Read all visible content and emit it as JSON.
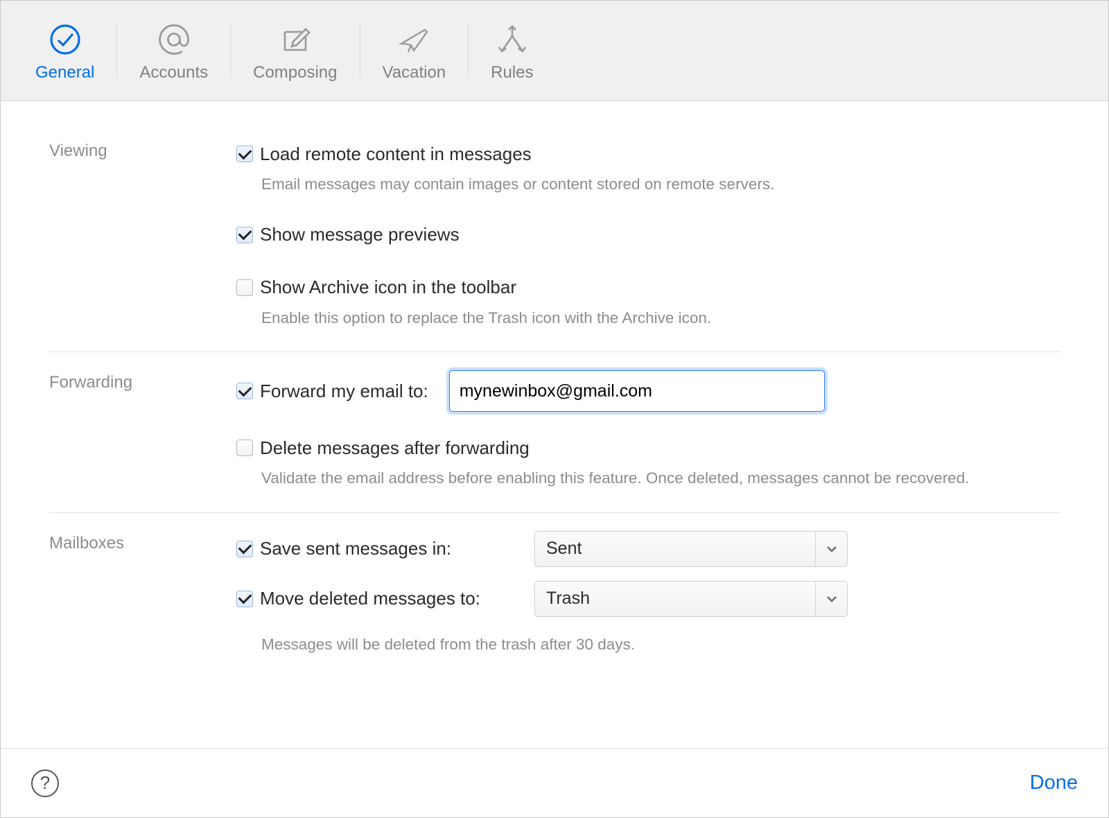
{
  "tabs": {
    "general": "General",
    "accounts": "Accounts",
    "composing": "Composing",
    "vacation": "Vacation",
    "rules": "Rules"
  },
  "sections": {
    "viewing_label": "Viewing",
    "forwarding_label": "Forwarding",
    "mailboxes_label": "Mailboxes"
  },
  "viewing": {
    "load_remote": "Load remote content in messages",
    "load_remote_help": "Email messages may contain images or content stored on remote servers.",
    "show_previews": "Show message previews",
    "show_archive": "Show Archive icon in the toolbar",
    "show_archive_help": "Enable this option to replace the Trash icon with the Archive icon."
  },
  "forwarding": {
    "forward_label": "Forward my email to:",
    "forward_value": "mynewinbox@gmail.com",
    "delete_after": "Delete messages after forwarding",
    "delete_help": "Validate the email address before enabling this feature. Once deleted, messages cannot be recovered."
  },
  "mailboxes": {
    "save_sent_label": "Save sent messages in:",
    "save_sent_value": "Sent",
    "move_deleted_label": "Move deleted messages to:",
    "move_deleted_value": "Trash",
    "trash_help": "Messages will be deleted from the trash after 30 days."
  },
  "footer": {
    "done": "Done"
  },
  "checks": {
    "load_remote": true,
    "show_previews": true,
    "show_archive": false,
    "forward": true,
    "delete_after": false,
    "save_sent": true,
    "move_deleted": true
  }
}
